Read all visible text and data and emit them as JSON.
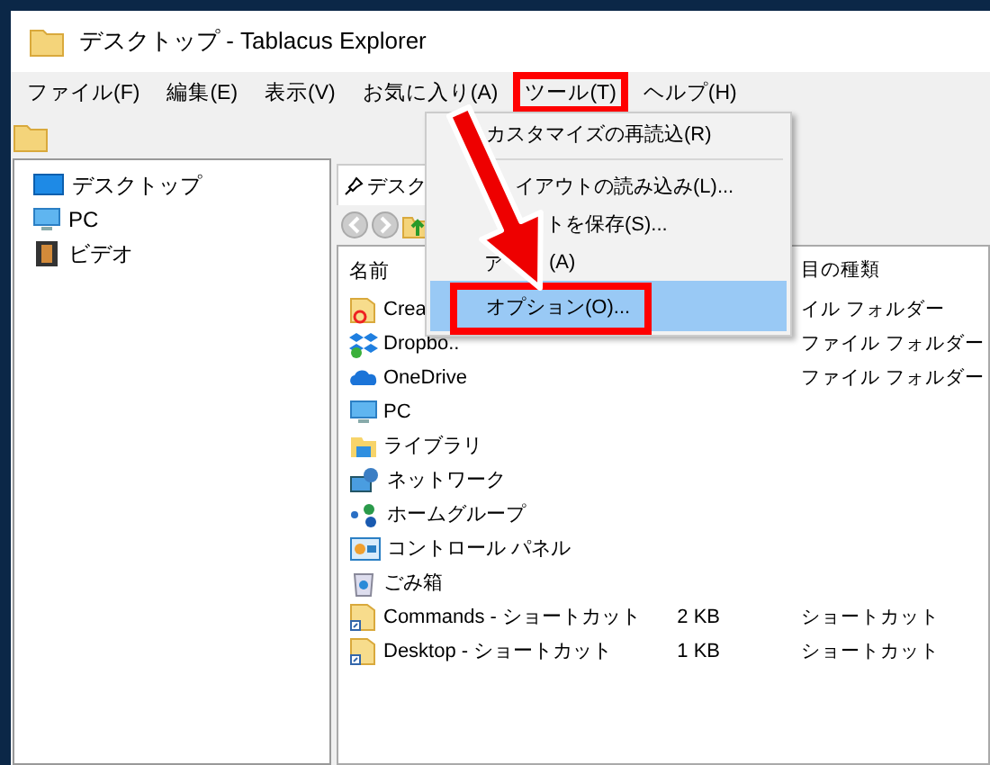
{
  "window": {
    "title": "デスクトップ - Tablacus Explorer"
  },
  "menu_bar": [
    {
      "label": "ファイル(F)",
      "open": false
    },
    {
      "label": "編集(E)",
      "open": false
    },
    {
      "label": "表示(V)",
      "open": false
    },
    {
      "label": "お気に入り(A)",
      "open": false
    },
    {
      "label": "ツール(T)",
      "open": true
    },
    {
      "label": "ヘルプ(H)",
      "open": false
    }
  ],
  "tree": [
    {
      "label": "デスクトップ",
      "kind": "desktop"
    },
    {
      "label": "PC",
      "kind": "pc"
    },
    {
      "label": "ビデオ",
      "kind": "video"
    }
  ],
  "tab": {
    "label": "デスク"
  },
  "columns": [
    {
      "label": "名前"
    },
    {
      "label": "目の種類"
    }
  ],
  "rows": [
    {
      "kind": "cc-folder",
      "name": "Crea",
      "type": "イル フォルダー"
    },
    {
      "kind": "dropbox",
      "name": "Dropbo..",
      "type": "ファイル フォルダー"
    },
    {
      "kind": "cloud",
      "name": "OneDrive",
      "type": "ファイル フォルダー"
    },
    {
      "kind": "pc",
      "name": "PC"
    },
    {
      "kind": "library",
      "name": "ライブラリ"
    },
    {
      "kind": "network",
      "name": "ネットワーク"
    },
    {
      "kind": "homegroup",
      "name": "ホームグループ"
    },
    {
      "kind": "control-panel",
      "name": "コントロール パネル"
    },
    {
      "kind": "trash",
      "name": "ごみ箱"
    },
    {
      "kind": "shortcut",
      "name": "Commands - ショートカット",
      "size": "2 KB",
      "type": "ショートカット"
    },
    {
      "kind": "shortcut",
      "name": "Desktop - ショートカット",
      "size": "1 KB",
      "type": "ショートカット"
    }
  ],
  "tools_menu": {
    "items": [
      {
        "kind": "item",
        "label": "カスタマイズの再読込(R)",
        "selected": false
      },
      {
        "kind": "separator"
      },
      {
        "kind": "item",
        "label": "イアウトの読み込み(L)...",
        "selected": false
      },
      {
        "kind": "item",
        "label": "トを保存(S)...",
        "selected": false
      },
      {
        "kind": "split",
        "parts": [
          "ア",
          "(A)"
        ],
        "selected": false
      },
      {
        "kind": "item",
        "label": "オプション(O)...",
        "selected": true
      }
    ]
  }
}
